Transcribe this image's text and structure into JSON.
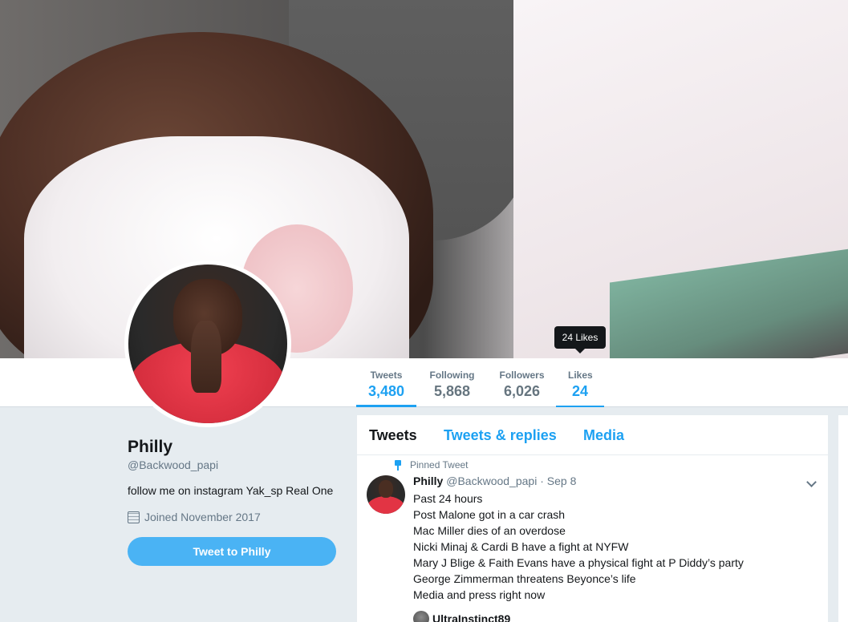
{
  "tooltip": "24 Likes",
  "nav": [
    {
      "label": "Tweets",
      "value": "3,480"
    },
    {
      "label": "Following",
      "value": "5,868"
    },
    {
      "label": "Followers",
      "value": "6,026"
    },
    {
      "label": "Likes",
      "value": "24"
    }
  ],
  "profile": {
    "name": "Philly",
    "handle": "@Backwood_papi",
    "bio": "follow me on instagram Yak_sp Real One",
    "joined": "Joined November 2017",
    "tweet_to_label": "Tweet to Philly"
  },
  "timeline": {
    "tabs": [
      "Tweets",
      "Tweets & replies",
      "Media"
    ],
    "pinned_label": "Pinned Tweet",
    "tweet": {
      "name": "Philly",
      "handle": "@Backwood_papi",
      "separator": "·",
      "date": "Sep 8",
      "lines": [
        "Past 24 hours",
        "Post Malone got in a car crash",
        "Mac Miller dies of an overdose",
        "Nicki Minaj & Cardi B have a fight at NYFW",
        "Mary J Blige & Faith Evans have a physical fight at P Diddy’s party",
        "George Zimmerman threatens Beyonce’s life",
        "Media and press right now"
      ],
      "quoted_user": "UltraInstinct89"
    }
  },
  "colors": {
    "accent": "#1da1f2",
    "button": "#4ab3f4",
    "background": "#e6ecf0"
  }
}
